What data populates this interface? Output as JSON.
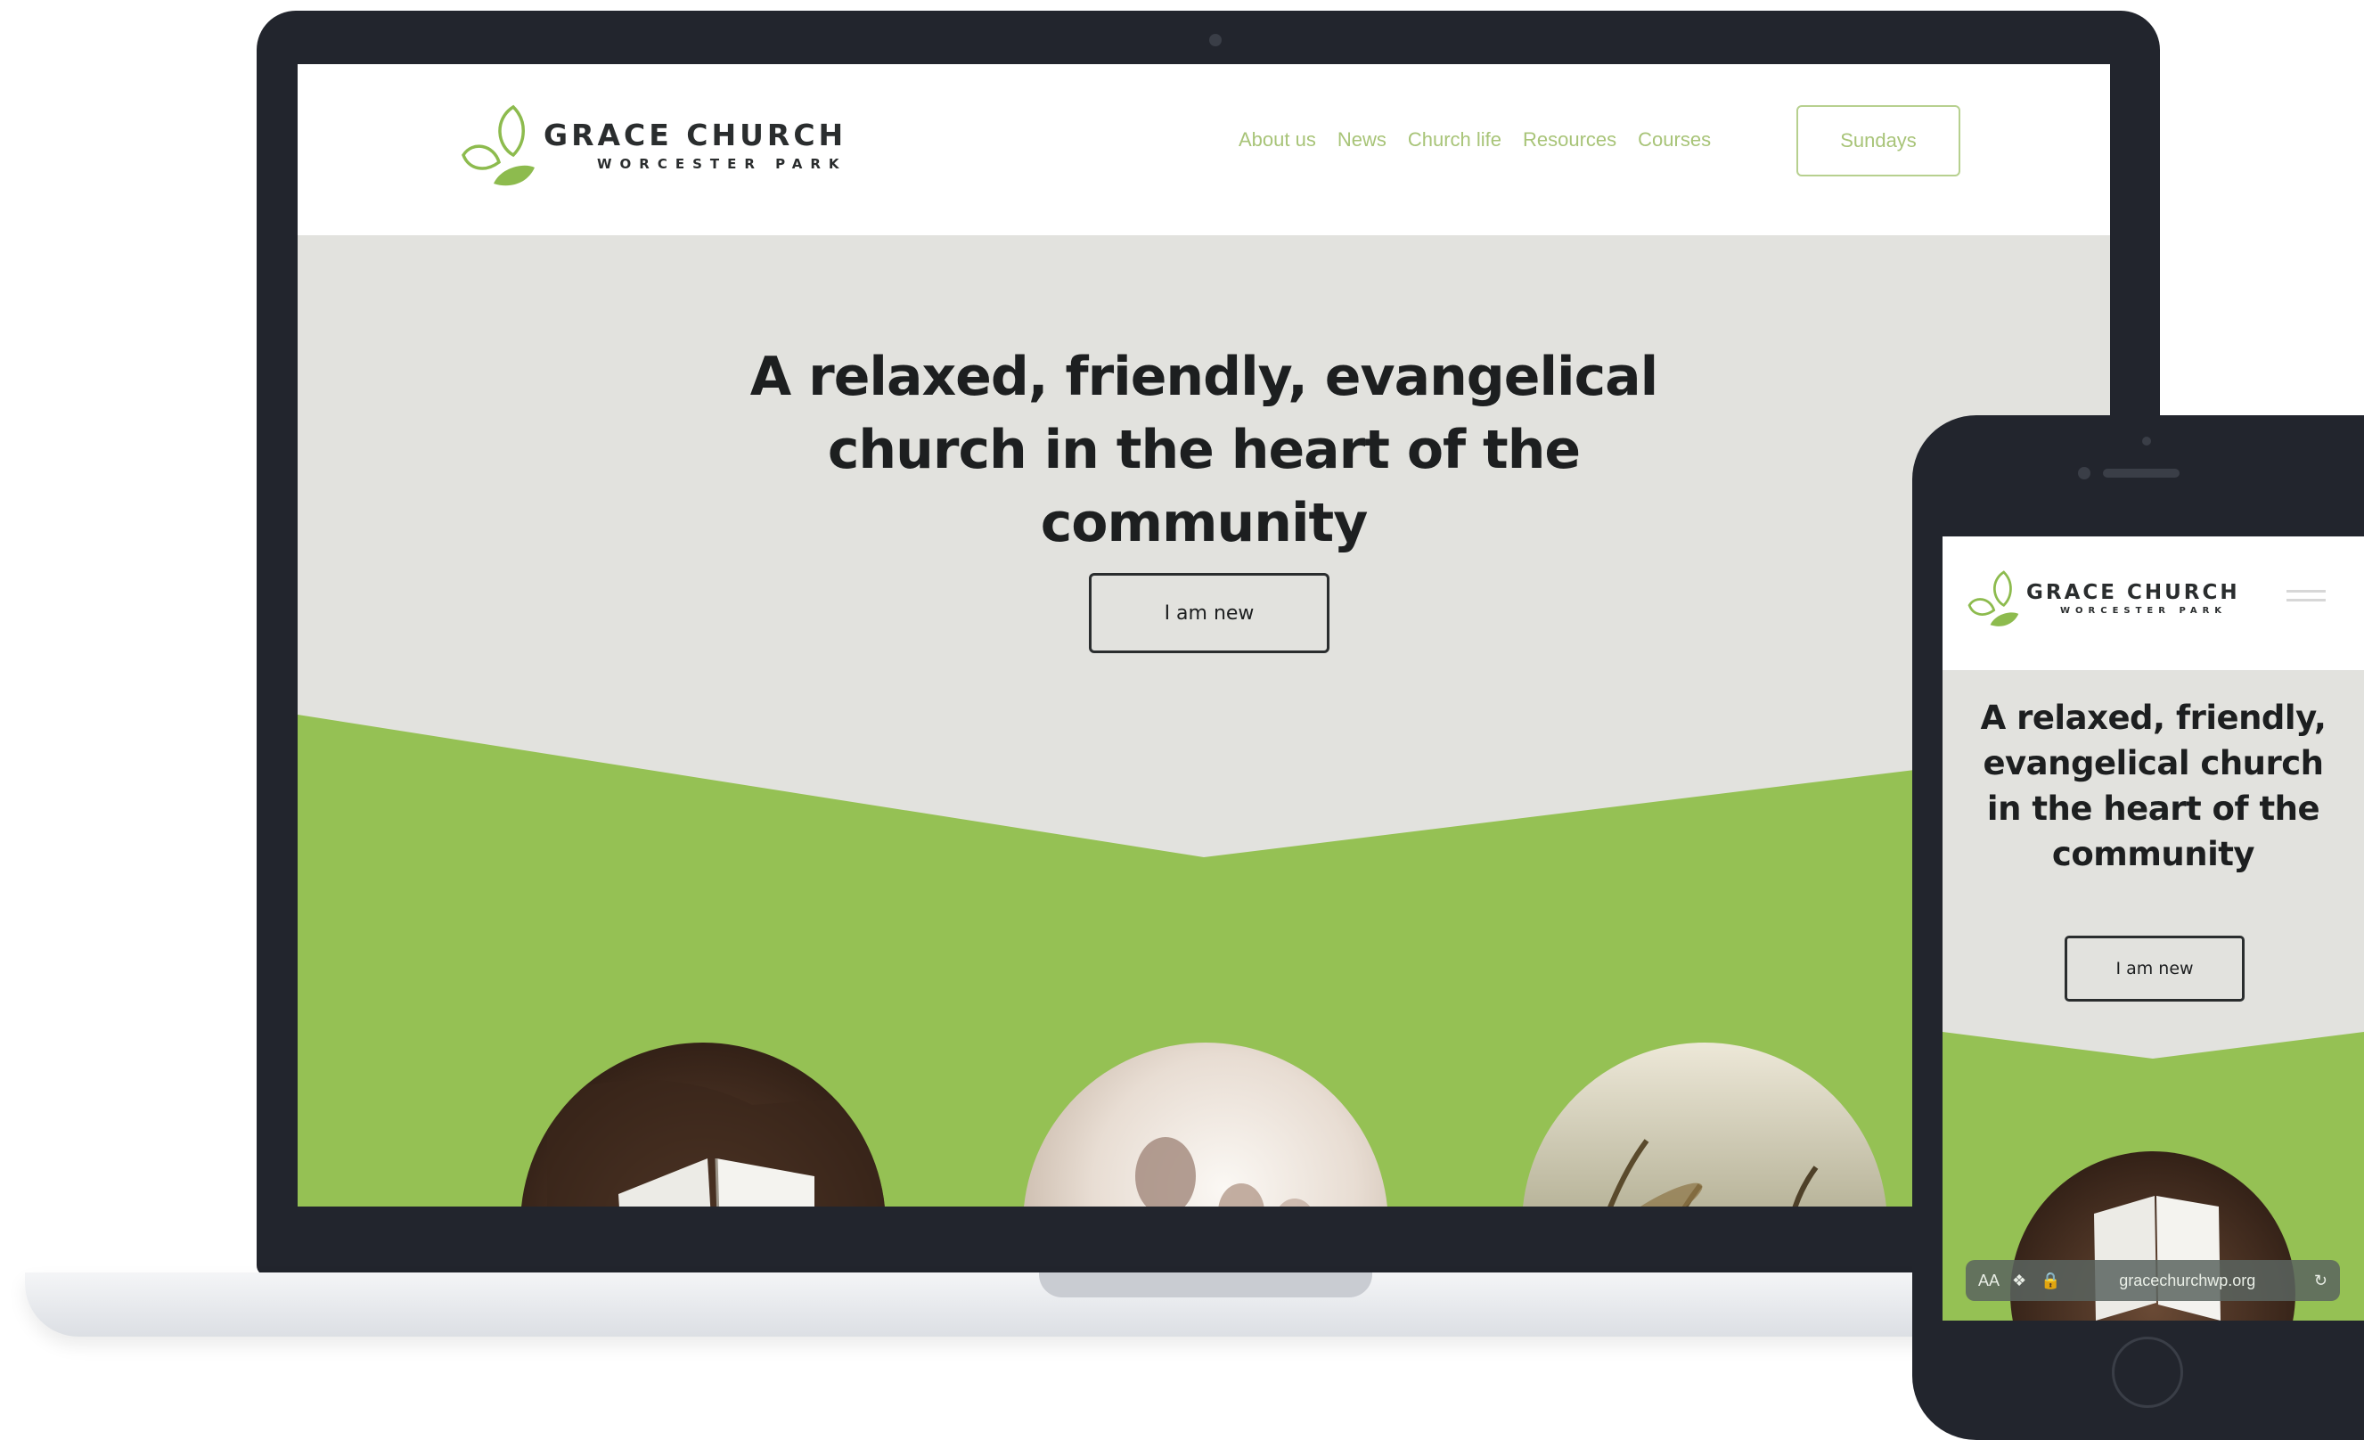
{
  "site": {
    "logo_title": "GRACE CHURCH",
    "logo_subtitle": "WORCESTER PARK"
  },
  "nav": {
    "items": [
      "About us",
      "News",
      "Church life",
      "Resources",
      "Courses"
    ],
    "cta": "Sundays"
  },
  "hero": {
    "title_lines": [
      "A relaxed, friendly, evangelical",
      "church in the heart of the",
      "community"
    ],
    "button": "I am new"
  },
  "mobile": {
    "title_lines": [
      "A relaxed, friendly,",
      "evangelical church",
      "in the heart of the",
      "community"
    ],
    "button": "I am new",
    "url_bar": {
      "aa": "AA",
      "url": "gracechurchwp.org"
    }
  },
  "colors": {
    "brand_green": "#95c154",
    "hero_grey": "#e2e2de",
    "device_dark": "#22252d",
    "nav_text": "#a8c478"
  },
  "icons": [
    "leaf-logo-icon",
    "hamburger-menu-icon",
    "reload-icon",
    "puzzle-icon"
  ]
}
